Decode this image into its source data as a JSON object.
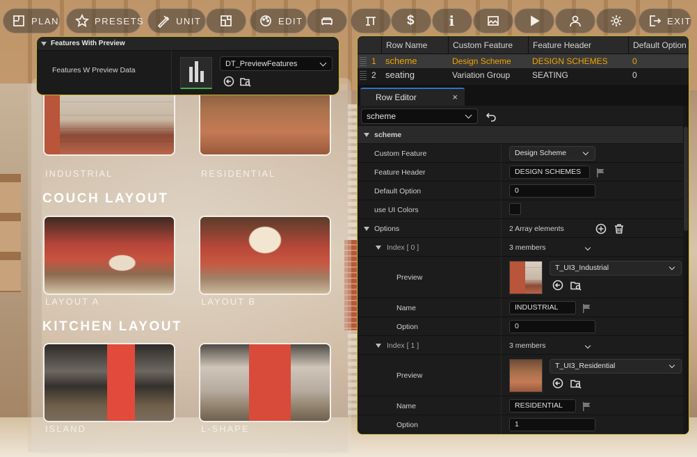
{
  "toolbar": {
    "plan": "PLAN",
    "presets": "PRESETS",
    "unit": "UNIT",
    "edit": "EDIT",
    "exit": "EXIT"
  },
  "preview": {
    "cards": [
      {
        "label": "INDUSTRIAL"
      },
      {
        "label": "RESIDENTIAL"
      },
      {
        "label": "LAYOUT A"
      },
      {
        "label": "LAYOUT B"
      },
      {
        "label": "ISLAND"
      },
      {
        "label": "L-SHAPE"
      }
    ],
    "couch_title": "COUCH LAYOUT",
    "kitchen_title": "KITCHEN LAYOUT"
  },
  "features_panel": {
    "title": "Features With Preview",
    "row_label": "Features W Preview Data",
    "asset": "DT_PreviewFeatures"
  },
  "table": {
    "headers": [
      "Row Name",
      "Custom Feature",
      "Feature Header",
      "Default Option"
    ],
    "rows": [
      {
        "num": "1",
        "name": "scheme",
        "feature": "Design Scheme",
        "header": "DESIGN SCHEMES",
        "default": "0"
      },
      {
        "num": "2",
        "name": "seating",
        "feature": "Variation Group",
        "header": "SEATING",
        "default": "0"
      }
    ]
  },
  "editor": {
    "tab": "Row Editor",
    "close": "×",
    "row_select": "scheme",
    "section": "scheme",
    "custom_feature_label": "Custom Feature",
    "custom_feature_value": "Design Scheme",
    "feature_header_label": "Feature Header",
    "feature_header_value": "DESIGN SCHEMES",
    "default_option_label": "Default Option",
    "default_option_value": "0",
    "use_ui_colors_label": "use UI Colors",
    "options_label": "Options",
    "options_count": "2 Array elements",
    "items": [
      {
        "index": "Index [ 0 ]",
        "members": "3 members",
        "preview_label": "Preview",
        "preview_asset": "T_UI3_Industrial",
        "name_label": "Name",
        "name_value": "INDUSTRIAL",
        "option_label": "Option",
        "option_value": "0"
      },
      {
        "index": "Index [ 1 ]",
        "members": "3 members",
        "preview_label": "Preview",
        "preview_asset": "T_UI3_Residential",
        "name_label": "Name",
        "name_value": "RESIDENTIAL",
        "option_label": "Option",
        "option_value": "1"
      }
    ]
  },
  "colors": {
    "accent_border": "#c7b233",
    "selected_text": "#f0a400",
    "tab_highlight": "#2b73c9"
  }
}
